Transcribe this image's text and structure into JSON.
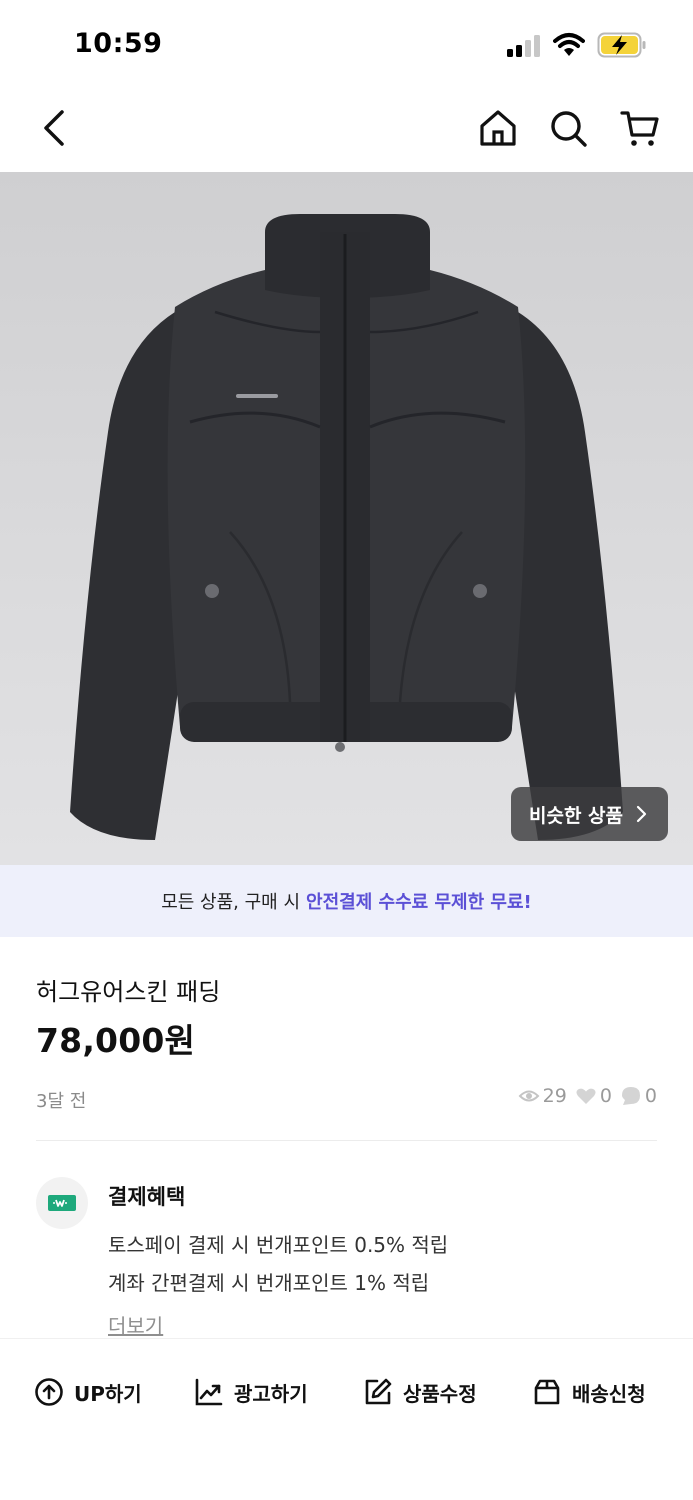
{
  "status_bar": {
    "time": "10:59",
    "icons": [
      "signal-icon",
      "wifi-icon",
      "battery-charging-icon"
    ],
    "battery_color": "#f4d33a"
  },
  "nav": {
    "icons": [
      "back-chevron-icon",
      "home-icon",
      "search-icon",
      "cart-icon"
    ]
  },
  "product_image": {
    "similar_button_label": "비슷한 상품"
  },
  "banner": {
    "text_prefix": "모든 상품, 구매 시",
    "text_highlight": "안전결제 수수료 무제한 무료!",
    "highlight_color": "#5b50d6"
  },
  "product": {
    "title": "허그유어스킨 패딩",
    "price": "78,000원",
    "posted": "3달 전",
    "views": "29",
    "likes": "0",
    "chats": "0"
  },
  "benefits": {
    "title": "결제혜택",
    "line1": "토스페이 결제 시 번개포인트 0.5% 적립",
    "line2": "계좌 간편결제 시 번개포인트 1% 적립",
    "more": "더보기",
    "icon": "payment-wallet-icon",
    "icon_color": "#1ea97c"
  },
  "bottom_actions": [
    {
      "label": "UP하기",
      "icon": "arrow-up-circle-icon"
    },
    {
      "label": "광고하기",
      "icon": "trend-chart-icon"
    },
    {
      "label": "상품수정",
      "icon": "edit-pencil-icon"
    },
    {
      "label": "배송신청",
      "icon": "box-icon"
    }
  ]
}
